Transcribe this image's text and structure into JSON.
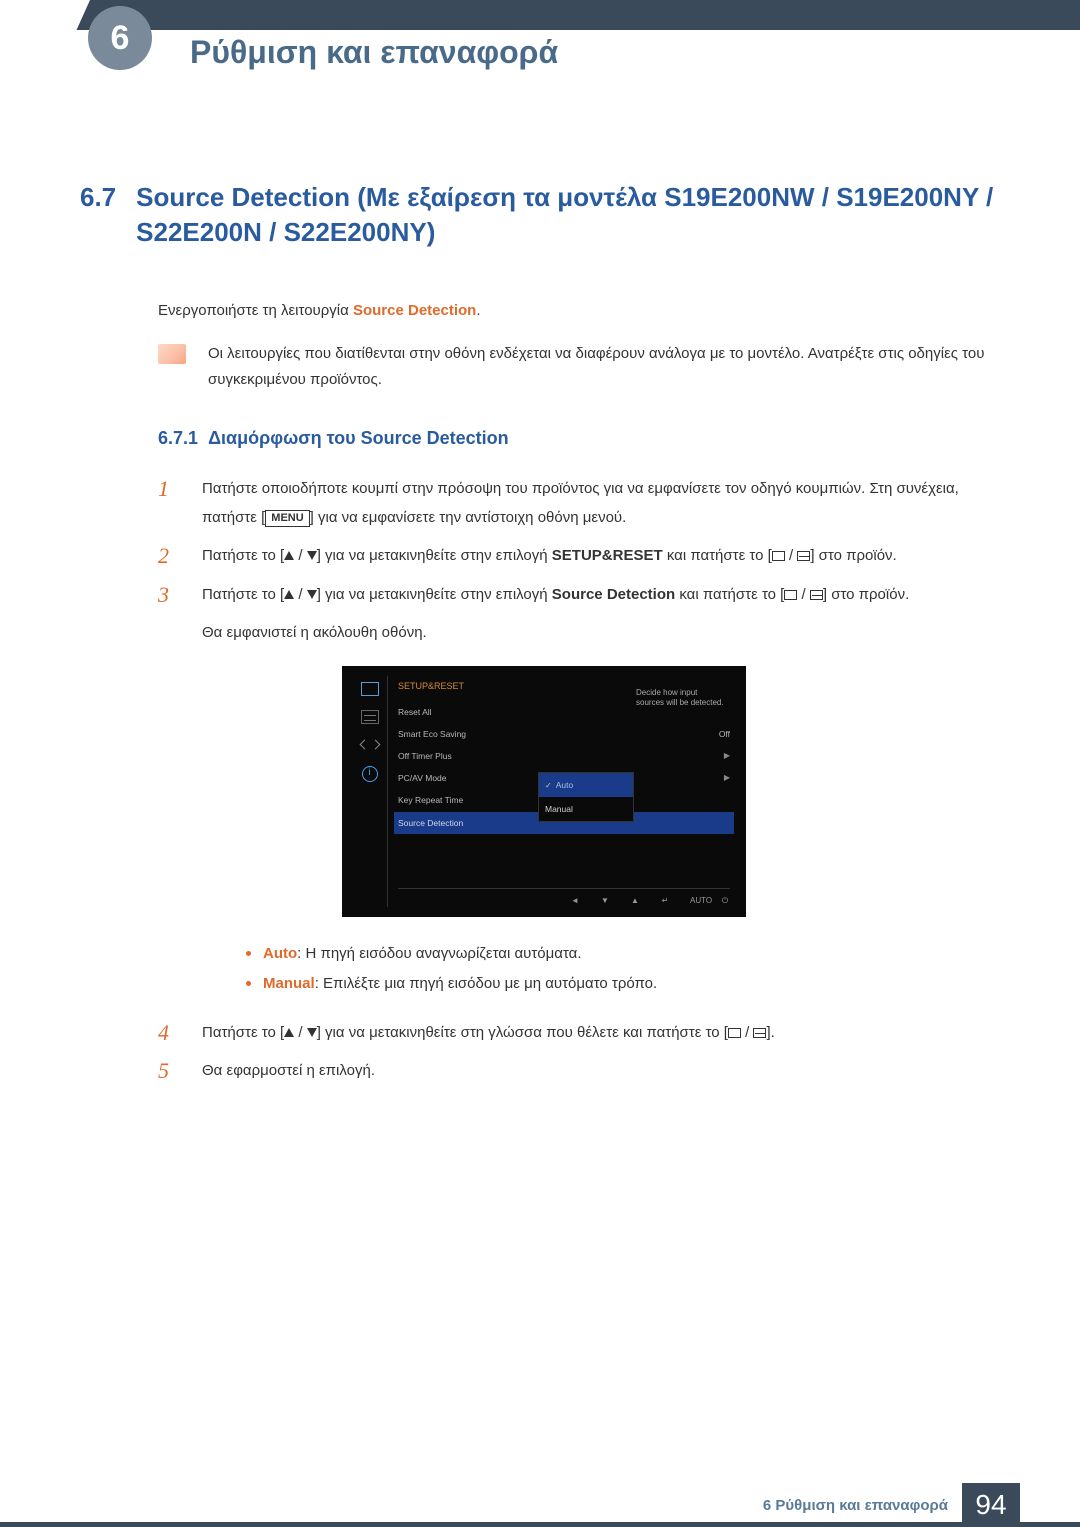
{
  "chapter_badge": "6",
  "page_title": "Ρύθμιση και επαναφορά",
  "section": {
    "number": "6.7",
    "title": "Source Detection (Με εξαίρεση τα μοντέλα S19E200NW / S19E200NY / S22E200N / S22E200NY)"
  },
  "intro_prefix": "Ενεργοποιήστε τη λειτουργία ",
  "intro_hl": "Source Detection",
  "intro_suffix": ".",
  "note": "Οι λειτουργίες που διατίθενται στην οθόνη ενδέχεται να διαφέρουν ανάλογα με το μοντέλο. Ανατρέξτε στις οδηγίες του συγκεκριμένου προϊόντος.",
  "subsection": {
    "number": "6.7.1",
    "title": "Διαμόρφωση του Source Detection"
  },
  "steps": {
    "s1_a": "Πατήστε οποιοδήποτε κουμπί στην πρόσοψη του προϊόντος για να εμφανίσετε τον οδηγό κουμπιών. Στη συνέχεια, πατήστε [",
    "s1_menu": "MENU",
    "s1_b": "] για να εμφανίσετε την αντίστοιχη οθόνη μενού.",
    "s2_a": "Πατήστε το [",
    "s2_b": "] για να μετακινηθείτε στην επιλογή ",
    "s2_hl": "SETUP&RESET",
    "s2_c": " και πατήστε το [",
    "s2_d": "] στο προϊόν.",
    "s3_a": "Πατήστε το [",
    "s3_b": "] για να μετακινηθείτε στην επιλογή ",
    "s3_hl": "Source Detection",
    "s3_c": " και πατήστε το [",
    "s3_d": "] στο προϊόν.",
    "s3_e": "Θα εμφανιστεί η ακόλουθη οθόνη.",
    "s4_a": "Πατήστε το [",
    "s4_b": "] για να μετακινηθείτε στη γλώσσα που θέλετε και πατήστε το [",
    "s4_c": "].",
    "s5": "Θα εφαρμοστεί η επιλογή."
  },
  "bullets": {
    "auto_label": "Auto",
    "auto_text": ": Η πηγή εισόδου αναγνωρίζεται αυτόματα.",
    "manual_label": "Manual",
    "manual_text": ": Επιλέξτε μια πηγή εισόδου με μη αυτόματο τρόπο."
  },
  "osd": {
    "title": "SETUP&RESET",
    "items": [
      {
        "label": "Reset All",
        "value": ""
      },
      {
        "label": "Smart Eco Saving",
        "value": "Off"
      },
      {
        "label": "Off Timer Plus",
        "value": "▶"
      },
      {
        "label": "PC/AV Mode",
        "value": "▶"
      },
      {
        "label": "Key Repeat Time",
        "value": ""
      },
      {
        "label": "Source Detection",
        "value": ""
      }
    ],
    "submenu": [
      "Auto",
      "Manual"
    ],
    "desc": "Decide how input sources will be detected.",
    "footer": [
      "◄",
      "▼",
      "▲",
      "↵",
      "AUTO",
      "⏻"
    ]
  },
  "footer": {
    "chapter": "6 Ρύθμιση και επαναφορά",
    "page": "94"
  }
}
